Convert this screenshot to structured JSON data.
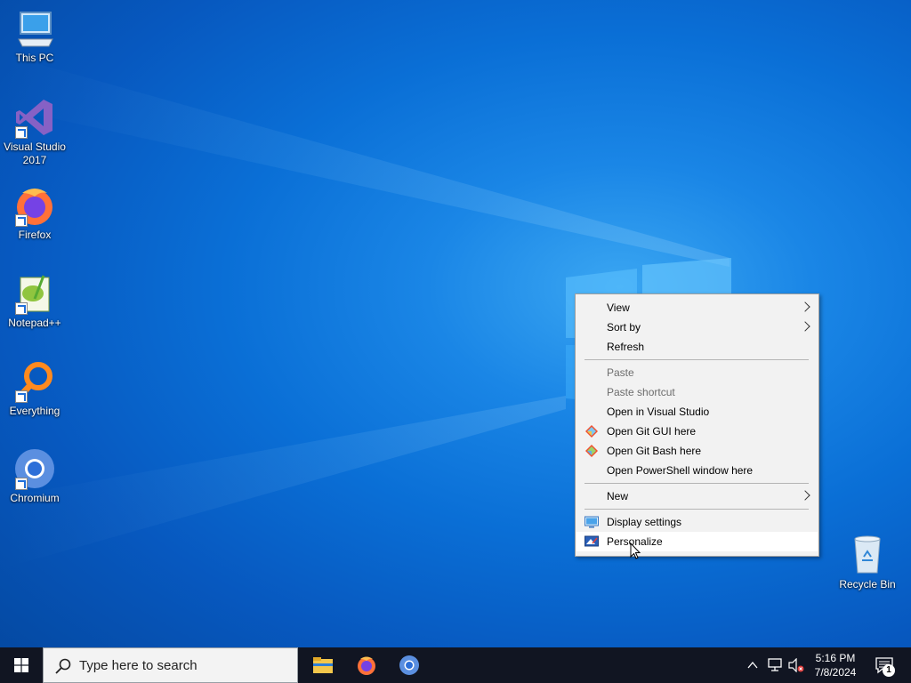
{
  "desktop": {
    "icons": [
      {
        "label": "This PC"
      },
      {
        "label": "Visual Studio\n2017"
      },
      {
        "label": "Firefox"
      },
      {
        "label": "Notepad++"
      },
      {
        "label": "Everything"
      },
      {
        "label": "Chromium"
      },
      {
        "label": "Recycle Bin"
      }
    ]
  },
  "context_menu": {
    "items": [
      {
        "label": "View",
        "submenu": true
      },
      {
        "label": "Sort by",
        "submenu": true
      },
      {
        "label": "Refresh"
      },
      {
        "label": "Paste",
        "disabled": true
      },
      {
        "label": "Paste shortcut",
        "disabled": true
      },
      {
        "label": "Open in Visual Studio"
      },
      {
        "label": "Open Git GUI here",
        "icon": "git-gui-icon"
      },
      {
        "label": "Open Git Bash here",
        "icon": "git-bash-icon"
      },
      {
        "label": "Open PowerShell window here"
      },
      {
        "label": "New",
        "submenu": true
      },
      {
        "label": "Display settings",
        "icon": "display-settings-icon"
      },
      {
        "label": "Personalize",
        "icon": "personalize-icon",
        "highlighted": true
      }
    ]
  },
  "taskbar": {
    "search_placeholder": "Type here to search",
    "pinned": [
      "file-explorer-icon",
      "firefox-icon",
      "chromium-icon"
    ],
    "tray_icons": [
      "chevron-up-icon",
      "network-icon",
      "volume-muted-icon"
    ],
    "time": "5:16 PM",
    "date": "7/8/2024",
    "notification_count": "1"
  },
  "colors": {
    "desktop_accent": "#0a6fd6",
    "taskbar": "#111522",
    "menu_bg": "#f2f2f2"
  }
}
